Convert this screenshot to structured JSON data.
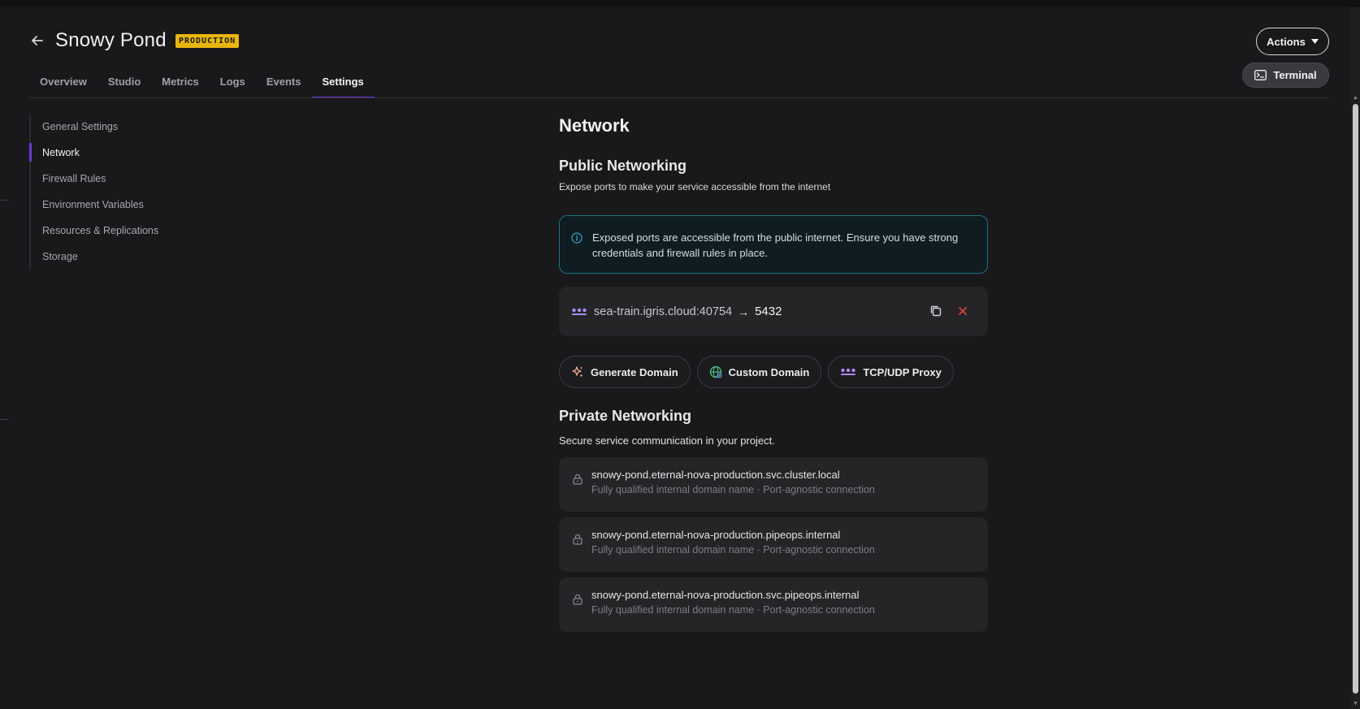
{
  "header": {
    "title": "Snowy Pond",
    "environment_badge": "PRODUCTION",
    "actions_label": "Actions",
    "terminal_label": "Terminal"
  },
  "tabs": [
    {
      "label": "Overview"
    },
    {
      "label": "Studio"
    },
    {
      "label": "Metrics"
    },
    {
      "label": "Logs"
    },
    {
      "label": "Events"
    },
    {
      "label": "Settings",
      "active": true
    }
  ],
  "sidebar": {
    "items": [
      {
        "label": "General Settings"
      },
      {
        "label": "Network",
        "active": true
      },
      {
        "label": "Firewall Rules"
      },
      {
        "label": "Environment Variables"
      },
      {
        "label": "Resources & Replications"
      },
      {
        "label": "Storage"
      }
    ]
  },
  "network": {
    "title": "Network",
    "public": {
      "title": "Public Networking",
      "description": "Expose ports to make your service accessible from the internet",
      "notice": "Exposed ports are accessible from the public internet. Ensure you have strong credentials and firewall rules in place.",
      "port_mapping": {
        "host": "sea-train.igris.cloud:40754",
        "arrow": "→",
        "port": "5432"
      },
      "buttons": {
        "generate_domain": "Generate Domain",
        "custom_domain": "Custom Domain",
        "tcp_udp_proxy": "TCP/UDP Proxy"
      }
    },
    "private": {
      "title": "Private Networking",
      "description": "Secure service communication in your project.",
      "endpoints": [
        {
          "name": "snowy-pond.eternal-nova-production.svc.cluster.local",
          "meta": "Fully qualified internal domain name · Port-agnostic connection"
        },
        {
          "name": "snowy-pond.eternal-nova-production.pipeops.internal",
          "meta": "Fully qualified internal domain name · Port-agnostic connection"
        },
        {
          "name": "snowy-pond.eternal-nova-production.svc.pipeops.internal",
          "meta": "Fully qualified internal domain name · Port-agnostic connection"
        }
      ]
    }
  },
  "colors": {
    "background": "#19191b",
    "accent": "#6a39d8",
    "badge": "#e8b60c",
    "notice_border": "#1f6f80",
    "danger": "#e0443c"
  },
  "icons": {
    "back": "arrow-left-icon",
    "actions": "caret-down-icon",
    "terminal": "terminal-icon",
    "notice": "info-circle-icon",
    "port": "network-nodes-icon",
    "copy": "copy-icon",
    "remove": "close-icon",
    "generate": "sparkles-icon",
    "custom": "globe-icon",
    "proxy": "network-nodes-icon",
    "endpoint": "lock-icon"
  }
}
